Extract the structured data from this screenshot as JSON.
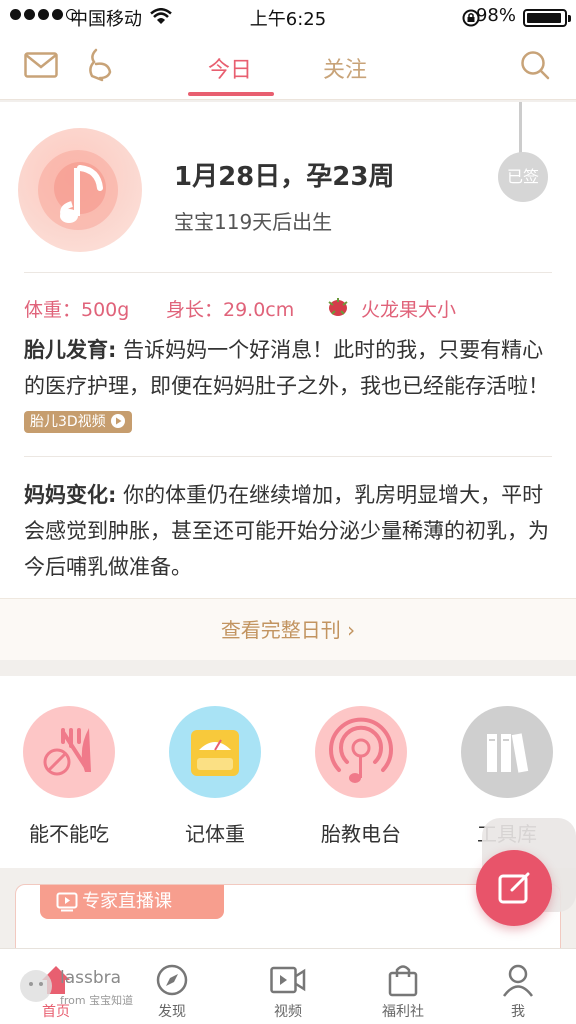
{
  "status_bar": {
    "carrier": "中国移动",
    "time": "上午6:25",
    "battery": "98%"
  },
  "header": {
    "tabs": [
      {
        "label": "今日",
        "active": true
      },
      {
        "label": "关注",
        "active": false
      }
    ],
    "icons": [
      "mail-icon",
      "pregnancy-icon",
      "search-icon"
    ]
  },
  "today": {
    "date_week": "1月28日，孕23周",
    "birth_countdown": "宝宝119天后出生",
    "signed_label": "已签",
    "weight": "体重：500g",
    "length": "身长：29.0cm",
    "size_compare": "火龙果大小",
    "fetal_title": "胎儿发育:",
    "fetal_text": " 告诉妈妈一个好消息！此时的我，只要有精心的医疗护理，即便在妈妈肚子之外，我也已经能存活啦！",
    "video_button": "胎儿3D视频",
    "mom_title": "妈妈变化:",
    "mom_text": " 你的体重仍在继续增加，乳房明显增大，平时会感觉到肿胀，甚至还可能开始分泌少量稀薄的初乳，为今后哺乳做准备。",
    "full_journal": "查看完整日刊 ›"
  },
  "tools": [
    {
      "label": "能不能吃",
      "color": "#fdc6c6"
    },
    {
      "label": "记体重",
      "color": "#a9e3f5"
    },
    {
      "label": "胎教电台",
      "color": "#fdc6c6"
    },
    {
      "label": "工具库",
      "color": "#cfcfcf"
    }
  ],
  "live": {
    "tag": "专家直播课"
  },
  "watermark": {
    "brand": "lassbra",
    "from": "from 宝宝知道"
  },
  "nav": [
    {
      "label": "首页",
      "active": true
    },
    {
      "label": "发现",
      "active": false
    },
    {
      "label": "视频",
      "active": false
    },
    {
      "label": "福利社",
      "active": false
    },
    {
      "label": "我",
      "active": false
    }
  ],
  "colors": {
    "accent": "#e85f70",
    "gold": "#c8a378",
    "bg": "#f2efec"
  }
}
